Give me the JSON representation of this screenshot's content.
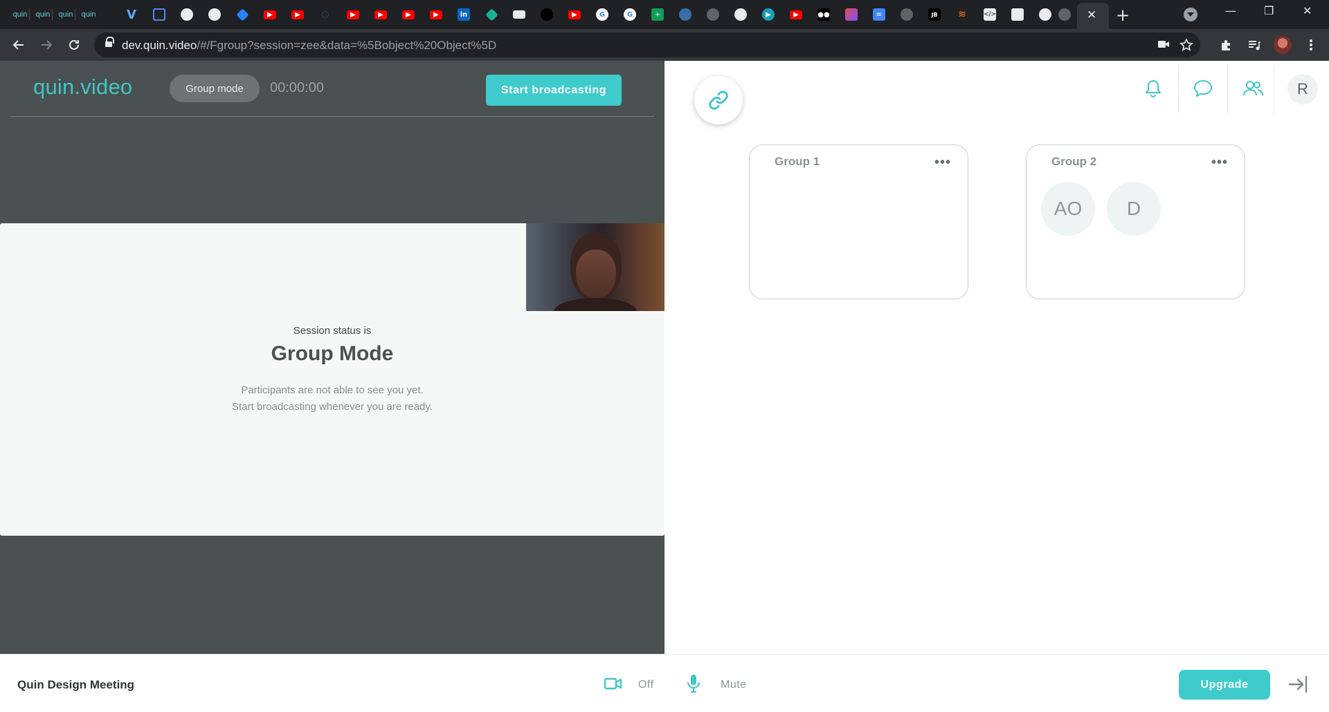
{
  "browser": {
    "tab_text_favicons": [
      "quin",
      "quin",
      "quin",
      "quin"
    ],
    "active_tab_close": "✕",
    "new_tab": "+",
    "window_controls": [
      "—",
      "❐",
      "✕"
    ],
    "url_host": "dev.quin.video",
    "url_path": "/#/Fgroup?session=zee&data=%5Bobject%20Object%5D"
  },
  "app": {
    "logo": "quin.video",
    "mode_pill": "Group mode",
    "timer": "00:00:00",
    "broadcast_label": "Start broadcasting",
    "status": {
      "label": "Session status is",
      "mode": "Group Mode",
      "line1": "Participants are not able to see you yet.",
      "line2": "Start broadcasting whenever you are ready."
    }
  },
  "right_panel": {
    "user_initial": "R",
    "groups": [
      {
        "title": "Group 1",
        "menu": "•••",
        "members": []
      },
      {
        "title": "Group 2",
        "menu": "•••",
        "members": [
          "AO",
          "D"
        ]
      }
    ]
  },
  "bottom": {
    "meeting_title": "Quin Design Meeting",
    "camera_label": "Off",
    "mic_label": "Mute",
    "upgrade_label": "Upgrade"
  },
  "colors": {
    "accent": "#3fcbcb",
    "dark_pane": "#4a5150",
    "browser_dark": "#202124"
  }
}
